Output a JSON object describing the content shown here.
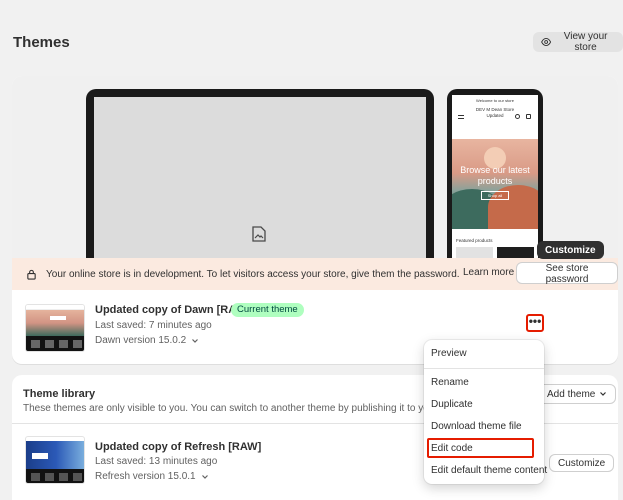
{
  "header": {
    "title": "Themes",
    "view_store_label": "View your store"
  },
  "preview": {
    "phone_announcement": "Welcome to our store",
    "phone_store_name": "DEV M Dean Store Updated",
    "phone_hero_title": "Browse our latest products",
    "phone_hero_button": "Shop all",
    "phone_featured": "Featured products"
  },
  "notice": {
    "text": "Your online store is in development. To let visitors access your store, give them the password.",
    "learn_more": "Learn more",
    "see_password": "See store password"
  },
  "current_theme": {
    "name": "Updated copy of Dawn [RAW]",
    "badge": "Current theme",
    "last_saved": "Last saved: 7 minutes ago",
    "version": "Dawn version 15.0.2",
    "customize_label": "Customize",
    "more_label": "•••"
  },
  "library": {
    "title": "Theme library",
    "description": "These themes are only visible to you. You can switch to another theme by publishing it to your store.",
    "add_theme_label": "Add theme",
    "themes": [
      {
        "name": "Updated copy of Refresh [RAW]",
        "last_saved": "Last saved: 13 minutes ago",
        "version": "Refresh version 15.0.1",
        "customize_label": "Customize"
      }
    ]
  },
  "menu": {
    "items": [
      "Preview",
      "Rename",
      "Duplicate",
      "Download theme file",
      "Edit code",
      "Edit default theme content"
    ]
  },
  "colors": {
    "page_bg": "#f1f1f1",
    "badge_bg": "#affebf",
    "notice_bg": "#fbeae0",
    "highlight": "#e51c00",
    "primary_button": "#303030"
  }
}
